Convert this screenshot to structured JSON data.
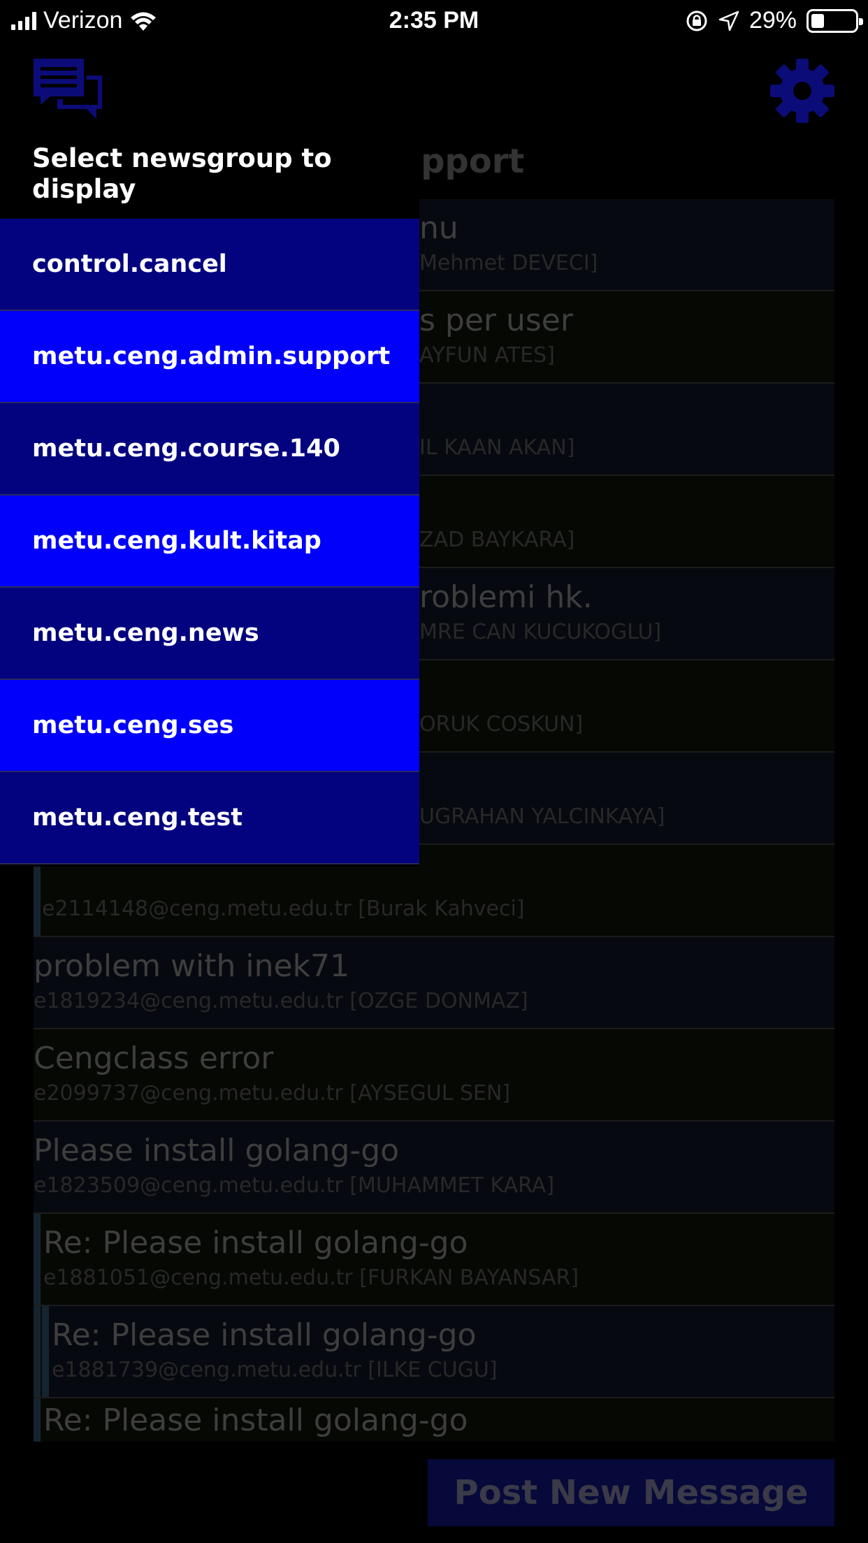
{
  "status_bar": {
    "carrier": "Verizon",
    "time": "2:35 PM",
    "battery": "29%"
  },
  "header": {
    "title": "metu.ceng.admin.support"
  },
  "drawer": {
    "title": "Select newsgroup to display",
    "groups": [
      {
        "label": "control.cancel"
      },
      {
        "label": "metu.ceng.admin.support"
      },
      {
        "label": "metu.ceng.course.140"
      },
      {
        "label": "metu.ceng.kult.kitap"
      },
      {
        "label": "metu.ceng.news"
      },
      {
        "label": "metu.ceng.ses"
      },
      {
        "label": "metu.ceng.test"
      }
    ]
  },
  "messages": [
    {
      "subject": "nu",
      "author": "Mehmet DEVECI]"
    },
    {
      "subject": "s per user",
      "author": "AYFUN ATES]"
    },
    {
      "subject": "",
      "author": "IL KAAN AKAN]"
    },
    {
      "subject": "",
      "author": "ZAD BAYKARA]"
    },
    {
      "subject": "roblemi hk.",
      "author": "MRE CAN KUCUKOGLU]"
    },
    {
      "subject": "",
      "author": "ORUK COSKUN]"
    },
    {
      "subject": "",
      "author": "UGRAHAN YALCINKAYA]"
    },
    {
      "subject": "",
      "author": "e2114148@ceng.metu.edu.tr [Burak Kahveci]"
    },
    {
      "subject": "problem with inek71",
      "author": "e1819234@ceng.metu.edu.tr [OZGE DONMAZ]"
    },
    {
      "subject": "Cengclass error",
      "author": "e2099737@ceng.metu.edu.tr [AYSEGUL SEN]"
    },
    {
      "subject": "Please install golang-go",
      "author": "e1823509@ceng.metu.edu.tr [MUHAMMET KARA]"
    },
    {
      "subject": "Re: Please install golang-go",
      "author": "e1881051@ceng.metu.edu.tr [FURKAN BAYANSAR]"
    },
    {
      "subject": "Re: Please install golang-go",
      "author": "e1881739@ceng.metu.edu.tr [ILKE CUGU]"
    },
    {
      "subject": "Re: Please install golang-go",
      "author": ""
    }
  ],
  "post_button": "Post New Message",
  "colors": {
    "drawer_dark": "#03037f",
    "drawer_bright": "#0000fb",
    "icon": "#0c0c78"
  },
  "icons": {
    "chat": "chat-bubbles-icon",
    "settings": "gear-icon"
  }
}
